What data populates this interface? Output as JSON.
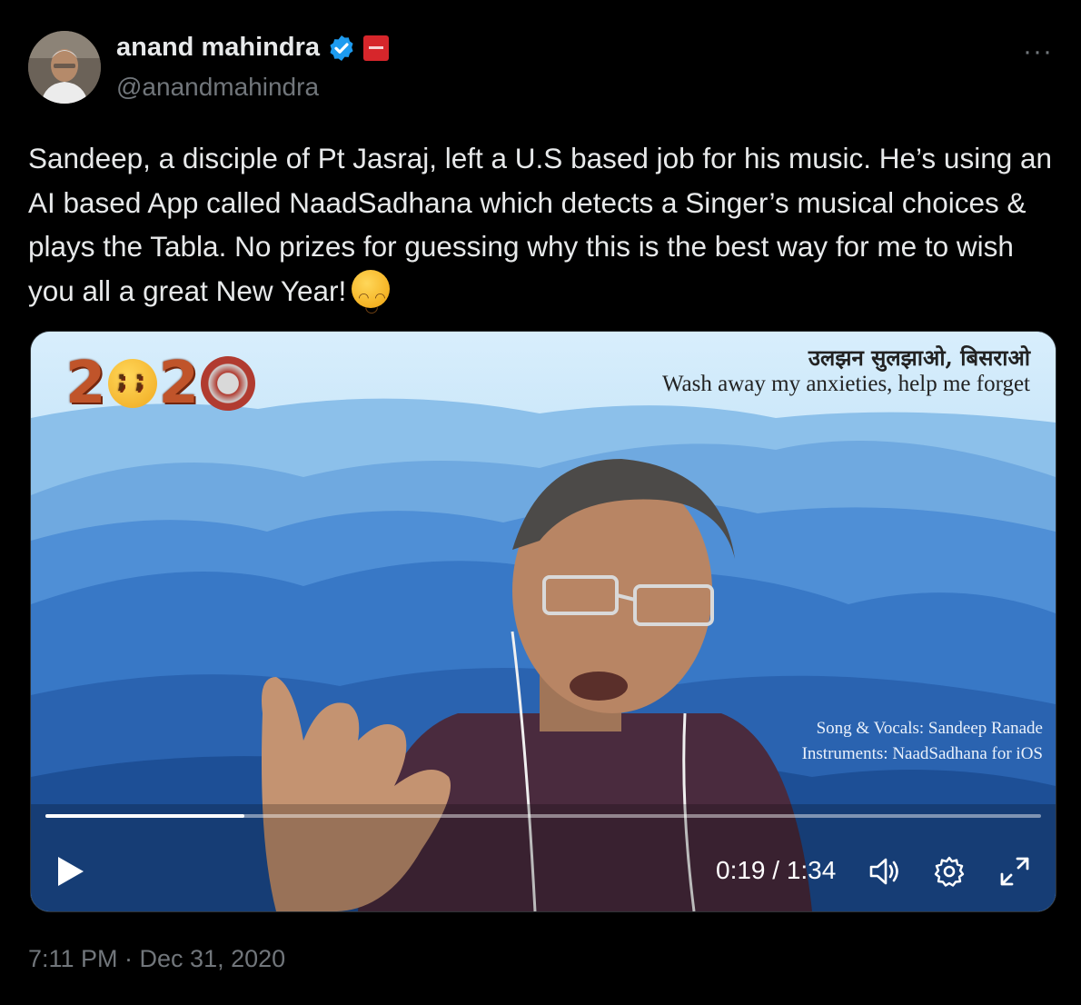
{
  "author": {
    "name": "anand mahindra",
    "handle": "@anandmahindra",
    "verified_color": "#1d9bf0",
    "affiliation_badge_color": "#d6262b"
  },
  "more_label": "···",
  "tweet": {
    "text": "Sandeep, a disciple of Pt Jasraj, left a U.S based job for his music. He’s using an AI based App called NaadSadhana which detects a Singer’s musical choices & plays the Tabla. No prizes for guessing why this is the best way for me to wish you all a great New Year!",
    "emoji": "smiling-face-with-smiling-eyes"
  },
  "video": {
    "overlay_hindi": "उलझन सुलझाओ, बिसराओ",
    "overlay_english": "Wash away my anxieties, help me forget",
    "year_digits": [
      "2",
      "2"
    ],
    "credit_line1": "Song & Vocals: Sandeep Ranade",
    "credit_line2": "Instruments: NaadSadhana for iOS",
    "time_display": "0:19 / 1:34",
    "progress_fraction": 0.2
  },
  "timestamp": "7:11 PM · Dec 31, 2020"
}
